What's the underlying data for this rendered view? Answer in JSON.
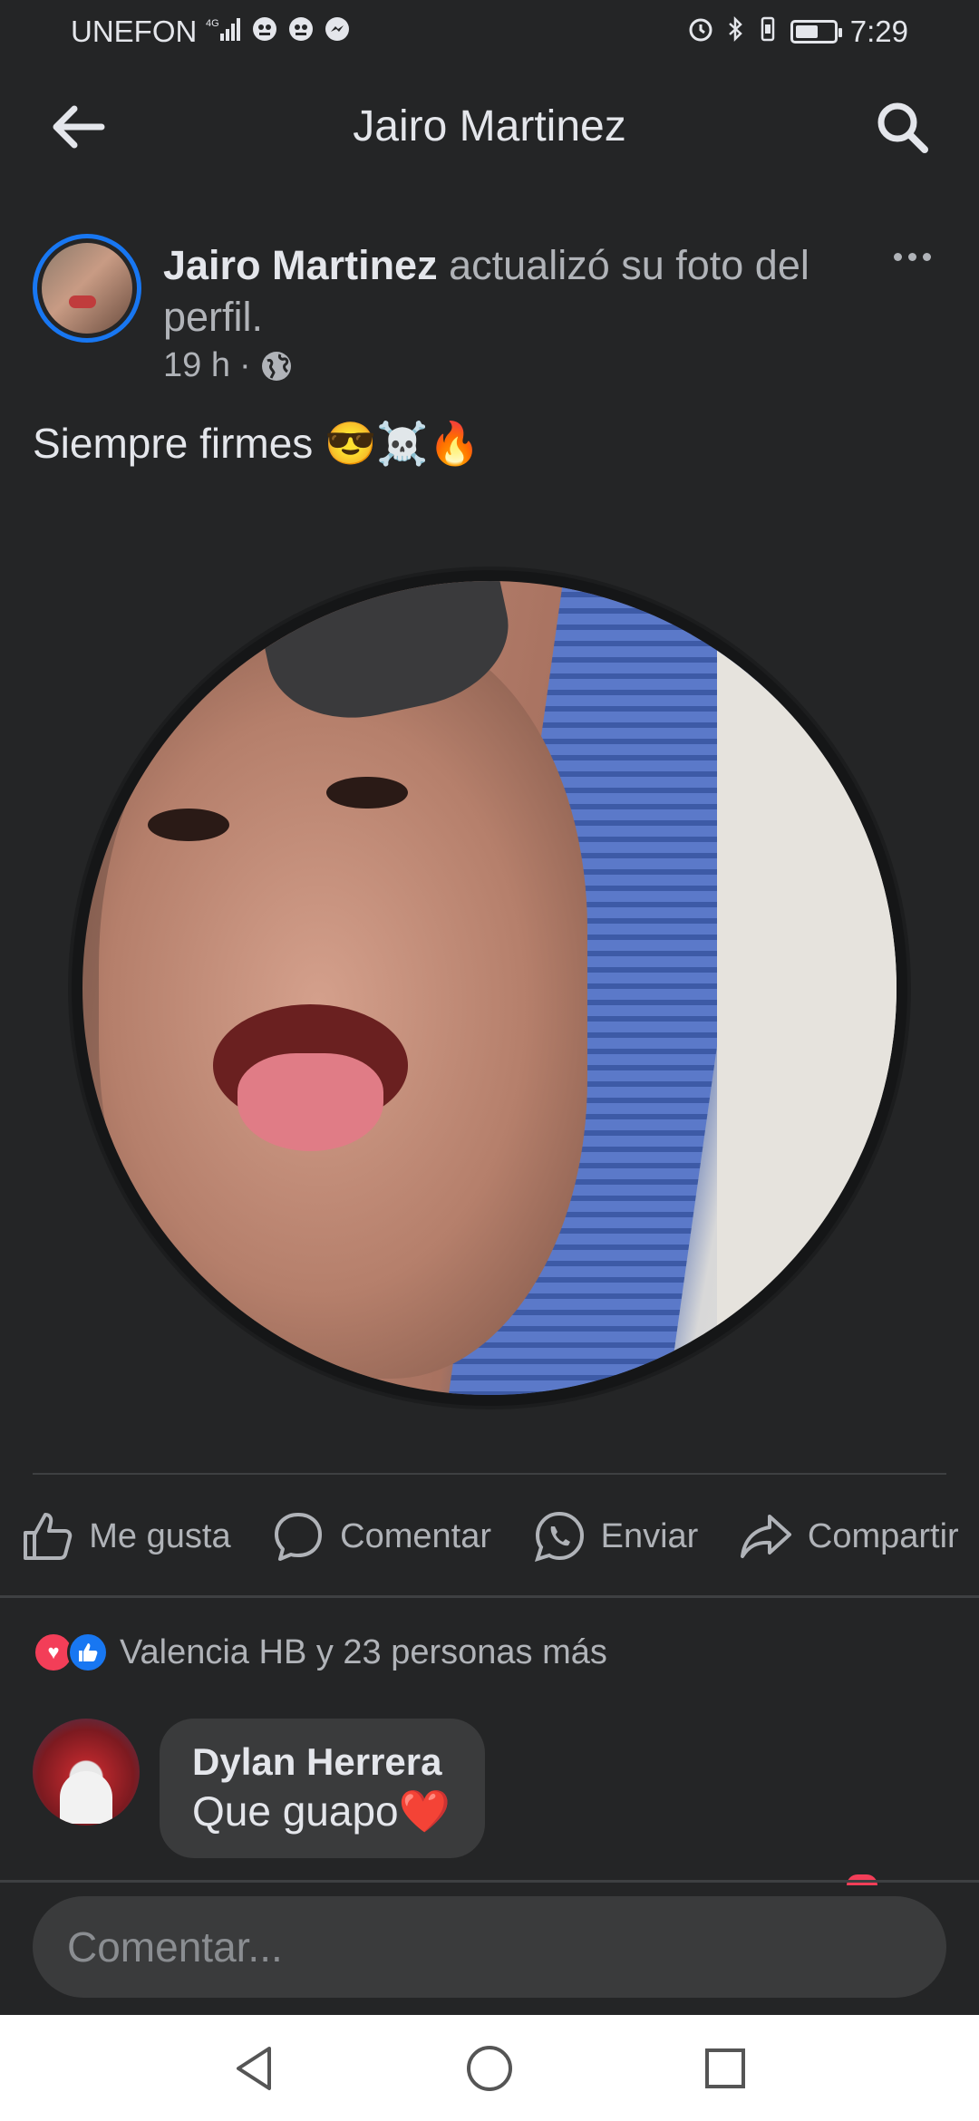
{
  "status_bar": {
    "carrier": "UNEFON",
    "network": "4G",
    "time": "7:29",
    "battery_level": 0.6,
    "icons": [
      "signal-icon",
      "notification-icon",
      "notification-icon",
      "messenger-icon",
      "alarm-icon",
      "bluetooth-icon",
      "vibrate-icon",
      "battery-icon"
    ]
  },
  "header": {
    "title": "Jairo Martinez",
    "back_icon": "arrow-left-icon",
    "search_icon": "search-icon"
  },
  "post": {
    "author": "Jairo Martinez",
    "action_text": "actualizó su foto del perfil.",
    "time": "19 h",
    "separator": "·",
    "privacy_icon": "globe-icon",
    "caption": "Siempre firmes 😎☠️🔥",
    "more_icon": "more-dots-icon"
  },
  "actions": [
    {
      "label": "Me gusta",
      "icon": "like-icon"
    },
    {
      "label": "Comentar",
      "icon": "comment-icon"
    },
    {
      "label": "Enviar",
      "icon": "whatsapp-icon"
    },
    {
      "label": "Compartir",
      "icon": "share-icon"
    }
  ],
  "reactions": {
    "summary": "Valencia HB y 23 personas más",
    "types": [
      "love",
      "like"
    ],
    "colors": {
      "love": "#f33e58",
      "like": "#1877f2"
    }
  },
  "comments": [
    {
      "author": "Dylan Herrera",
      "text": "Que guapo❤️"
    }
  ],
  "comment_input": {
    "placeholder": "Comentar..."
  },
  "nav_bar": {
    "buttons": [
      "back-triangle-icon",
      "home-circle-icon",
      "recents-square-icon"
    ]
  },
  "colors": {
    "background": "#242526",
    "accent": "#1877f2",
    "text_primary": "#e4e6eb",
    "text_secondary": "#b0b3b8"
  }
}
